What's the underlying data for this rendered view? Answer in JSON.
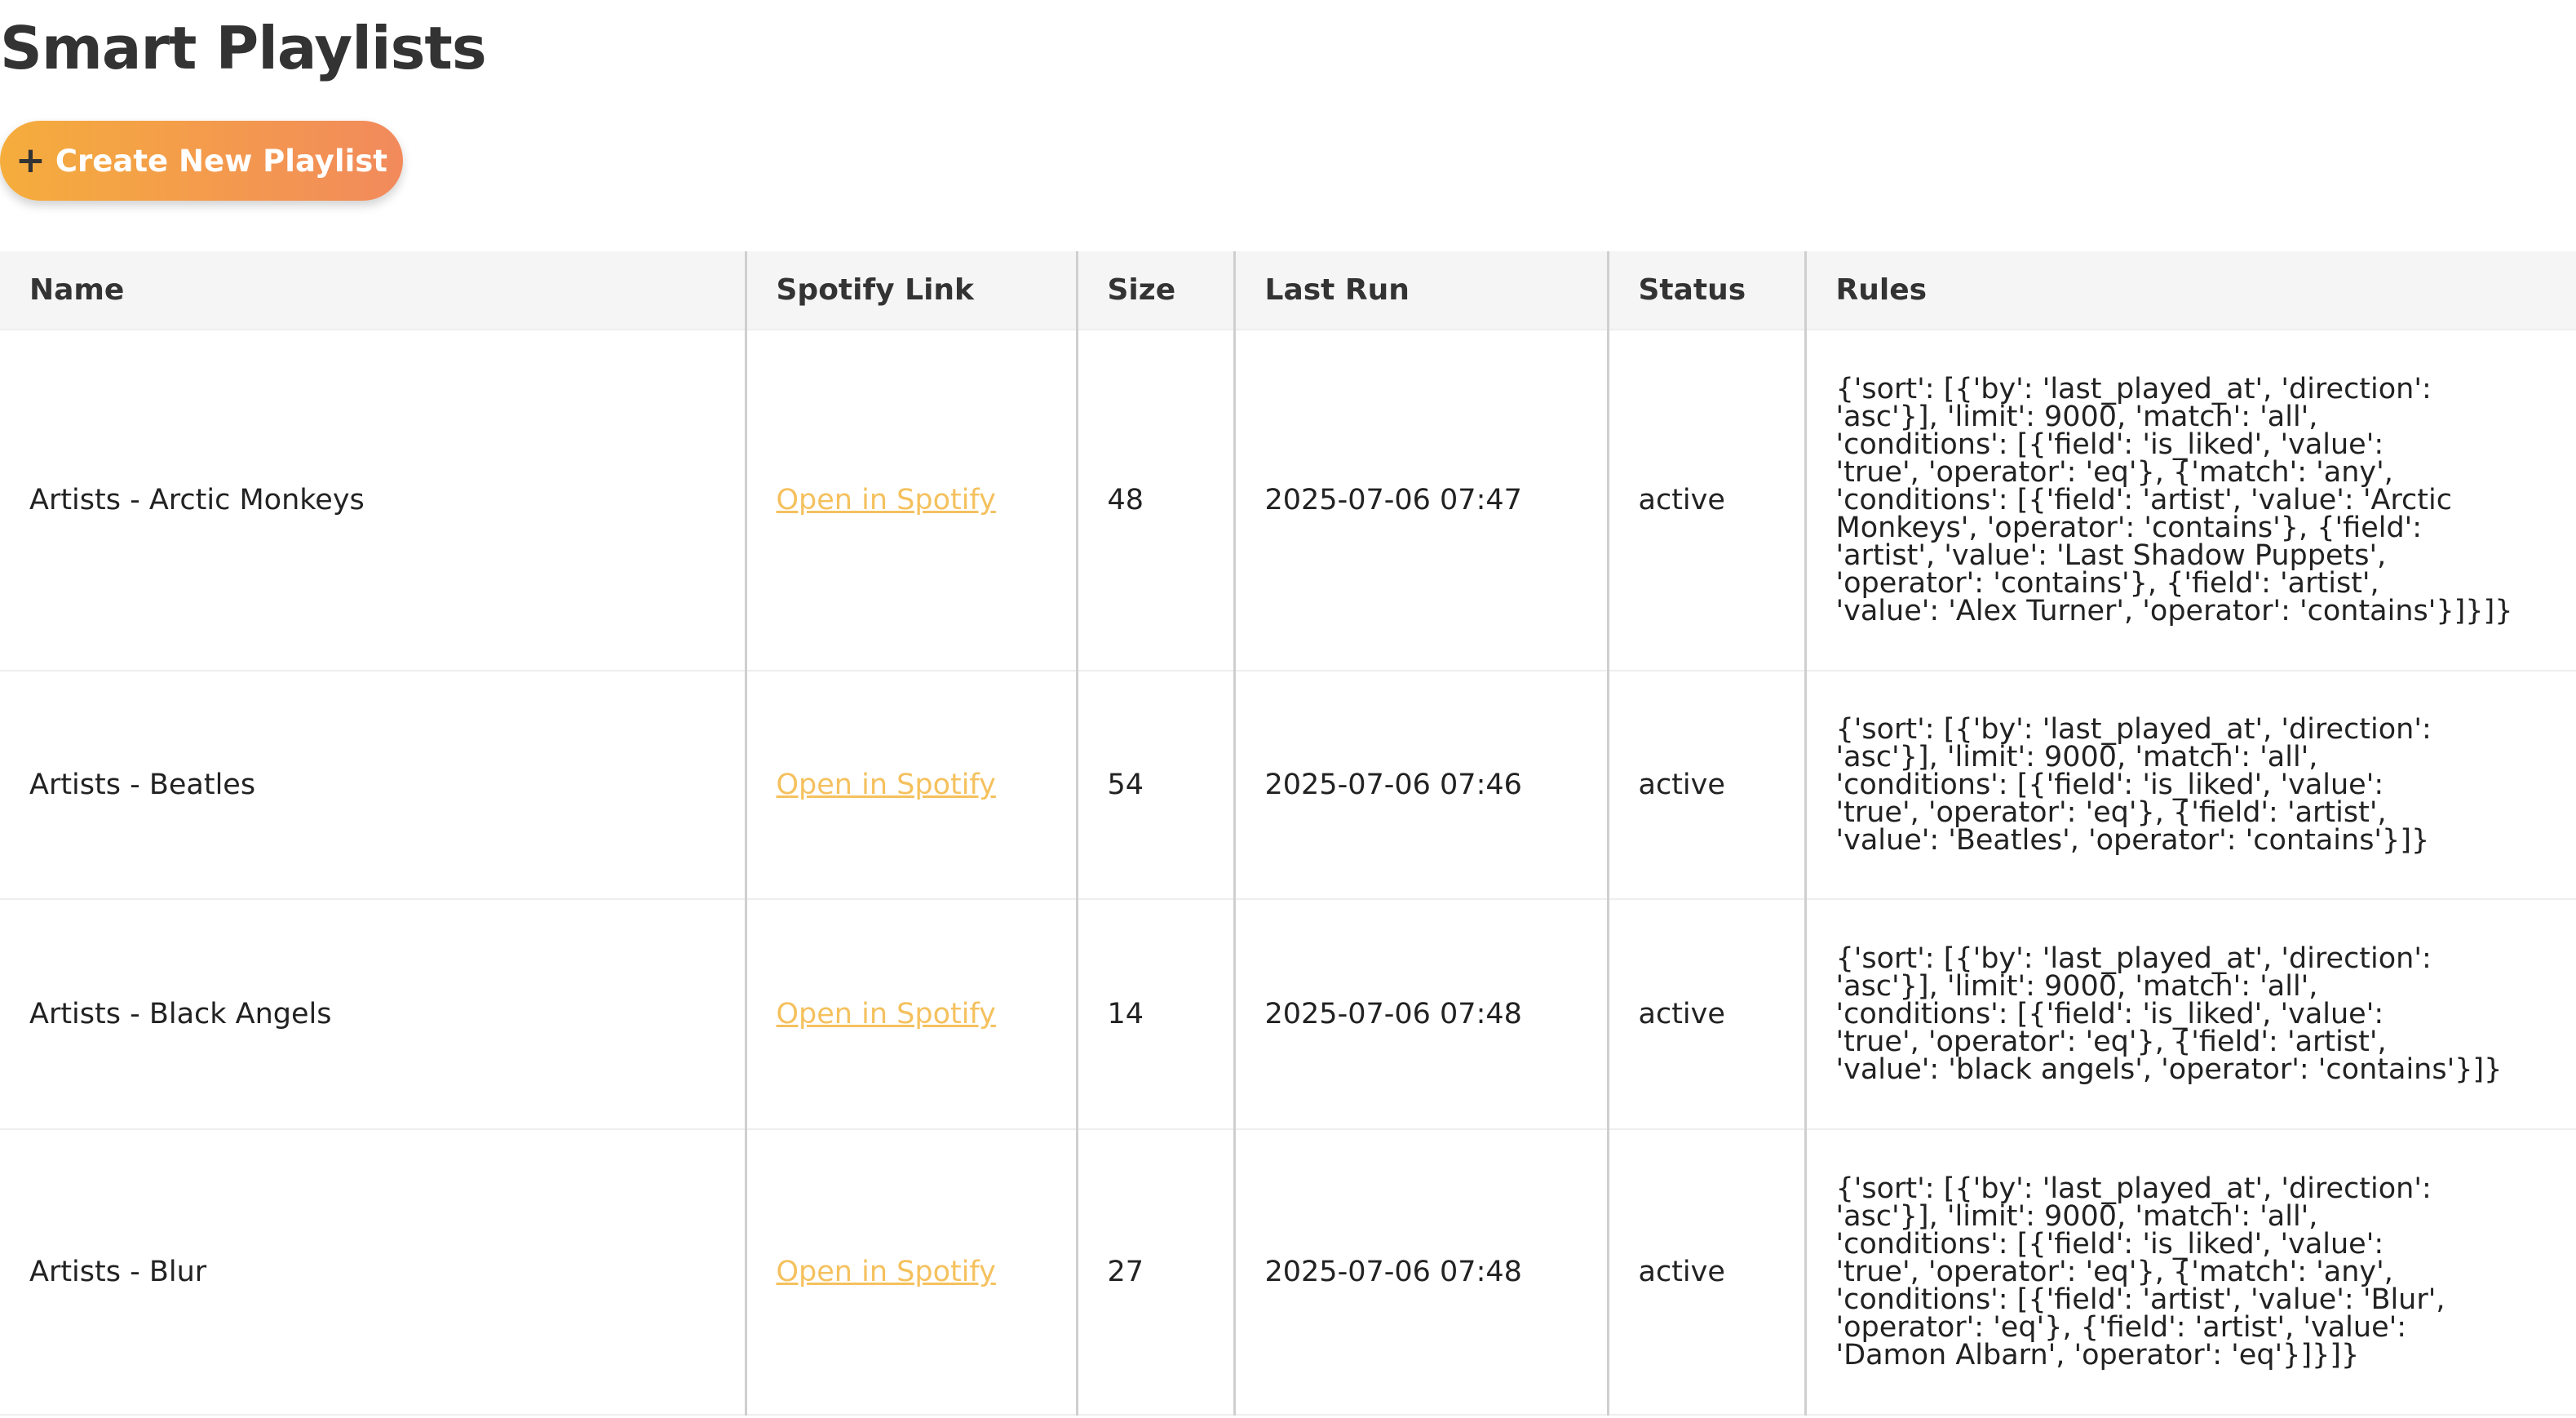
{
  "page": {
    "title": "Smart Playlists"
  },
  "toolbar": {
    "create_icon": "plus-icon",
    "create_label": "Create New Playlist"
  },
  "table": {
    "headers": {
      "name": "Name",
      "spotify_link": "Spotify Link",
      "size": "Size",
      "last_run": "Last Run",
      "status": "Status",
      "rules": "Rules"
    },
    "rows": [
      {
        "name": "Artists - Arctic Monkeys",
        "link_text": "Open in Spotify",
        "size": "48",
        "last_run": "2025-07-06 07:47",
        "status": "active",
        "rules": "{'sort': [{'by': 'last_played_at', 'direction':\n'asc'}], 'limit': 9000, 'match': 'all',\n'conditions': [{'field': 'is_liked', 'value':\n'true', 'operator': 'eq'}, {'match': 'any',\n'conditions': [{'field': 'artist', 'value': 'Arctic\nMonkeys', 'operator': 'contains'}, {'field':\n'artist', 'value': 'Last Shadow Puppets',\n'operator': 'contains'}, {'field': 'artist',\n'value': 'Alex Turner', 'operator': 'contains'}]}]}"
      },
      {
        "name": "Artists - Beatles",
        "link_text": "Open in Spotify",
        "size": "54",
        "last_run": "2025-07-06 07:46",
        "status": "active",
        "rules": "{'sort': [{'by': 'last_played_at', 'direction':\n'asc'}], 'limit': 9000, 'match': 'all',\n'conditions': [{'field': 'is_liked', 'value':\n'true', 'operator': 'eq'}, {'field': 'artist',\n'value': 'Beatles', 'operator': 'contains'}]}"
      },
      {
        "name": "Artists - Black Angels",
        "link_text": "Open in Spotify",
        "size": "14",
        "last_run": "2025-07-06 07:48",
        "status": "active",
        "rules": "{'sort': [{'by': 'last_played_at', 'direction':\n'asc'}], 'limit': 9000, 'match': 'all',\n'conditions': [{'field': 'is_liked', 'value':\n'true', 'operator': 'eq'}, {'field': 'artist',\n'value': 'black angels', 'operator': 'contains'}]}"
      },
      {
        "name": "Artists - Blur",
        "link_text": "Open in Spotify",
        "size": "27",
        "last_run": "2025-07-06 07:48",
        "status": "active",
        "rules": "{'sort': [{'by': 'last_played_at', 'direction':\n'asc'}], 'limit': 9000, 'match': 'all',\n'conditions': [{'field': 'is_liked', 'value':\n'true', 'operator': 'eq'}, {'match': 'any',\n'conditions': [{'field': 'artist', 'value': 'Blur',\n'operator': 'eq'}, {'field': 'artist', 'value':\n'Damon Albarn', 'operator': 'eq'}]}]}"
      }
    ]
  },
  "colors": {
    "button_gradient_start": "#f5ad3c",
    "button_gradient_end": "#f28a5c",
    "link": "#f5c15e",
    "header_background": "#f5f5f5"
  }
}
